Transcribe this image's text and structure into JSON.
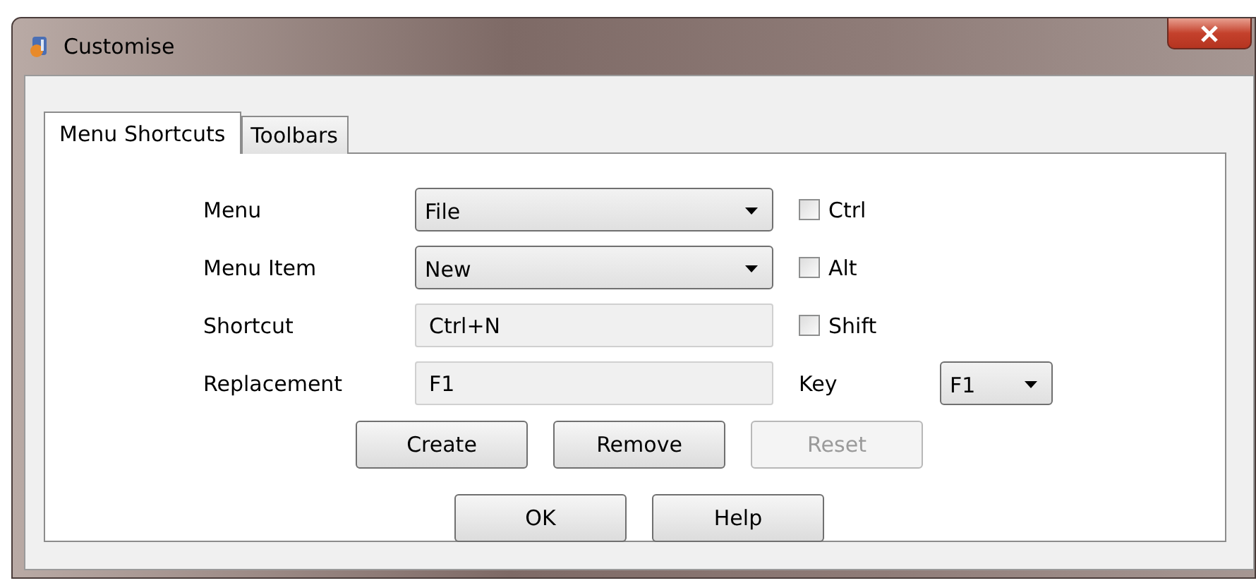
{
  "window": {
    "title": "Customise"
  },
  "tabs": [
    {
      "label": "Menu Shortcuts",
      "selected": true
    },
    {
      "label": "Toolbars",
      "selected": false
    }
  ],
  "rows": [
    {
      "label": "Menu",
      "kind": "dropdown",
      "value": "File",
      "modifier": {
        "label": "Ctrl",
        "checked": false
      }
    },
    {
      "label": "Menu Item",
      "kind": "dropdown",
      "value": "New",
      "modifier": {
        "label": "Alt",
        "checked": false
      }
    },
    {
      "label": "Shortcut",
      "kind": "readonly",
      "value": "Ctrl+N",
      "modifier": {
        "label": "Shift",
        "checked": false
      }
    },
    {
      "label": "Replacement",
      "kind": "readonly",
      "value": "F1",
      "key": {
        "label": "Key",
        "value": "F1"
      }
    }
  ],
  "action_buttons": [
    {
      "label": "Create",
      "disabled": false
    },
    {
      "label": "Remove",
      "disabled": false
    },
    {
      "label": "Reset",
      "disabled": true
    }
  ],
  "dialog_buttons": [
    {
      "label": "OK",
      "disabled": false
    },
    {
      "label": "Help",
      "disabled": false
    }
  ]
}
